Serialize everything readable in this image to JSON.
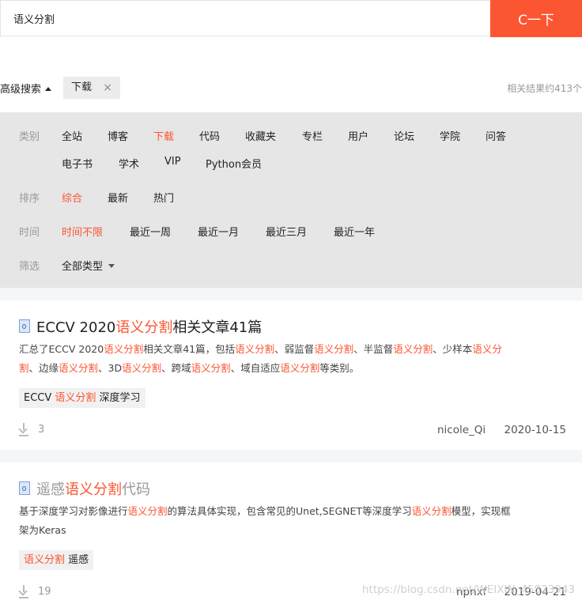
{
  "search": {
    "value": "语义分割",
    "button": "C一下"
  },
  "advanced": {
    "toggle_label": "高级搜索",
    "active_filter": "下载",
    "clear_icon": "×",
    "result_count": "相关结果约413个"
  },
  "filters": {
    "category": {
      "label": "类别",
      "options_row1": [
        "全站",
        "博客",
        "下载",
        "代码",
        "收藏夹",
        "专栏",
        "用户",
        "论坛",
        "学院",
        "问答"
      ],
      "options_row2": [
        "电子书",
        "学术",
        "VIP",
        "Python会员"
      ],
      "selected": "下载"
    },
    "sort": {
      "label": "排序",
      "options": [
        "综合",
        "最新",
        "热门"
      ],
      "selected": "综合"
    },
    "time": {
      "label": "时间",
      "options": [
        "时间不限",
        "最近一周",
        "最近一月",
        "最近三月",
        "最近一年"
      ],
      "selected": "时间不限"
    },
    "type": {
      "label": "筛选",
      "value": "全部类型"
    }
  },
  "results": [
    {
      "title_pre": "ECCV 2020",
      "title_hl": "语义分割",
      "title_post": "相关文章41篇",
      "desc_parts": [
        "汇总了ECCV 2020",
        "语义分割",
        "相关文章41篇，包括",
        "语义分割",
        "、弱监督",
        "语义分割",
        "、半监督",
        "语义分割",
        "、少样本",
        "语义分",
        "割",
        "、边缘",
        "语义分割",
        "、3D",
        "语义分割",
        "、跨域",
        "语义分割",
        "、域自适应",
        "语义分割",
        "等类别。"
      ],
      "tag_pre": "ECCV ",
      "tag_hl": "语义分割",
      "tag_post": " 深度学习",
      "downloads": "3",
      "author": "nicole_Qi",
      "date": "2020-10-15"
    },
    {
      "title_pre": "遥感",
      "title_hl": "语义分割",
      "title_post": "代码",
      "desc_parts": [
        "基于深度学习对影像进行",
        "语义分割",
        "的算法具体实现，包含常见的Unet,SEGNET等深度学习",
        "语义分割",
        "模型，实现框",
        "架为Keras"
      ],
      "tag_pre": "",
      "tag_hl": "语义分割",
      "tag_post": " 遥感",
      "downloads": "19",
      "author": "npnxf",
      "date": "2019-04-21"
    }
  ],
  "watermark": "https://blog.csdn.net/WEIXIN_45823943"
}
